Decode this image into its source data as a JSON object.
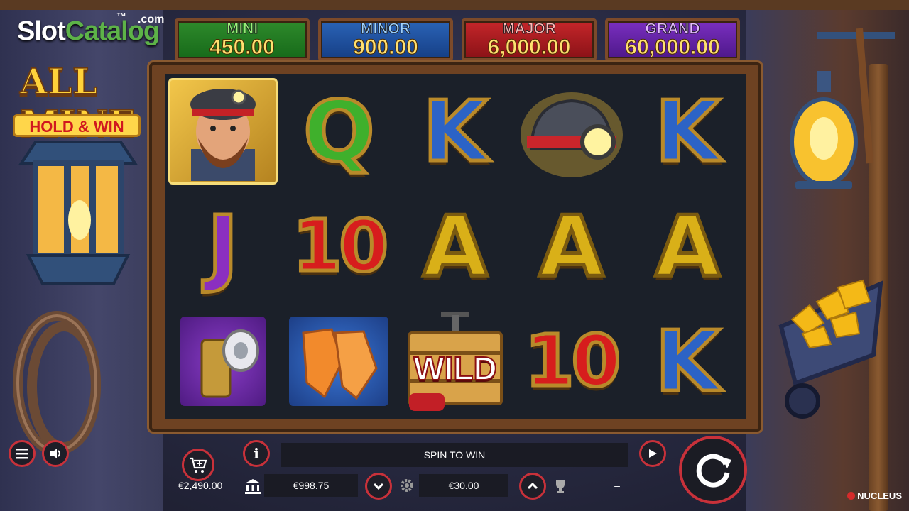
{
  "logo": {
    "watermark_part1": "Slot",
    "watermark_part2": "Catalog",
    "watermark_tm": "™",
    "watermark_suffix": ".com",
    "game_title": "ALL MINE",
    "badge": "HOLD & WIN"
  },
  "jackpots": [
    {
      "name": "MINI",
      "value": "450.00"
    },
    {
      "name": "MINOR",
      "value": "900.00"
    },
    {
      "name": "MAJOR",
      "value": "6,000.00"
    },
    {
      "name": "GRAND",
      "value": "60,000.00"
    }
  ],
  "reels": {
    "rows": [
      [
        "miner-portrait",
        "Q",
        "K",
        "helmet",
        "K"
      ],
      [
        "J",
        "10",
        "A",
        "A",
        "A"
      ],
      [
        "carbide-lamp",
        "gloves",
        "wild-dynamite",
        "10",
        "K"
      ]
    ],
    "wild_label": "WILD"
  },
  "controls": {
    "message": "SPIN TO WIN",
    "buy_amount": "€2,490.00",
    "balance": "€998.75",
    "bet": "€30.00",
    "win": "–",
    "info_label": "i"
  },
  "footer_brand": "NUCLEUS",
  "colors": {
    "accent": "#c8313a",
    "reel_bg": "#1b2029",
    "frame": "#6e4222"
  }
}
